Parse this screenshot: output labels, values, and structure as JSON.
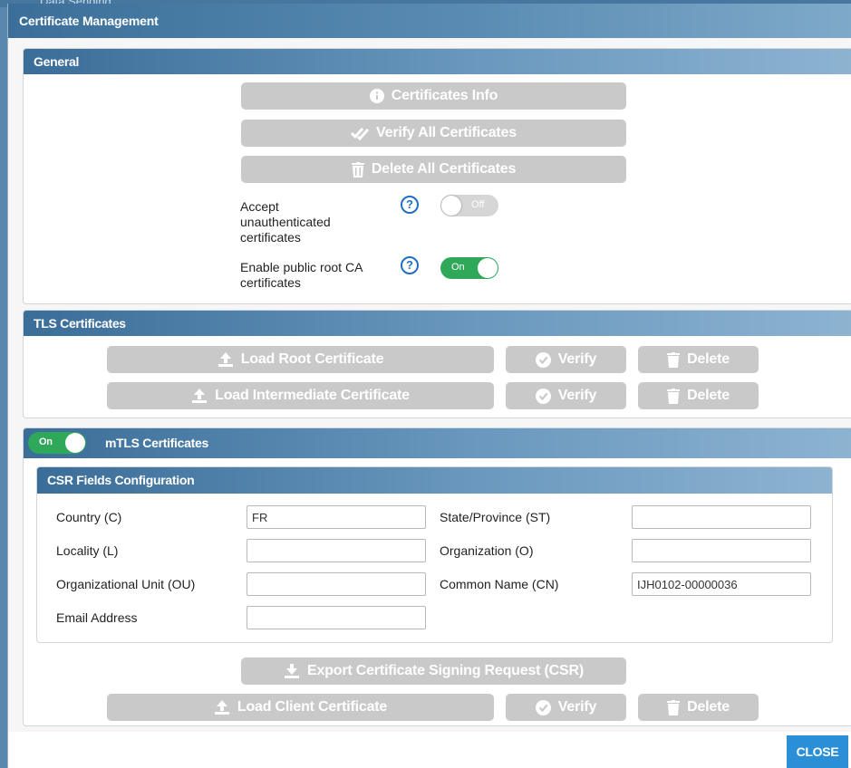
{
  "backdrop": {
    "title_partial": "Data Sending"
  },
  "dialog": {
    "title": "Certificate Management"
  },
  "general": {
    "header": "General",
    "buttons": {
      "info": "Certificates Info",
      "verify_all": "Verify All Certificates",
      "delete_all": "Delete All Certificates"
    },
    "options": [
      {
        "label": "Accept unauthenticated certificates",
        "state": "Off"
      },
      {
        "label": "Enable public root CA certificates",
        "state": "On"
      }
    ]
  },
  "tls": {
    "header": "TLS Certificates",
    "rows": [
      {
        "load": "Load Root Certificate",
        "verify": "Verify",
        "delete": "Delete"
      },
      {
        "load": "Load Intermediate Certificate",
        "verify": "Verify",
        "delete": "Delete"
      }
    ]
  },
  "mtls": {
    "toggle_state": "On",
    "header": "mTLS Certificates",
    "csr": {
      "header": "CSR Fields Configuration",
      "fields": [
        {
          "label": "Country (C)",
          "value": "FR"
        },
        {
          "label": "State/Province (ST)",
          "value": ""
        },
        {
          "label": "Locality (L)",
          "value": ""
        },
        {
          "label": "Organization (O)",
          "value": ""
        },
        {
          "label": "Organizational Unit (OU)",
          "value": ""
        },
        {
          "label": "Common Name (CN)",
          "value": "IJH0102-00000036"
        },
        {
          "label": "Email Address",
          "value": ""
        }
      ]
    },
    "export_label": "Export Certificate Signing Request (CSR)",
    "client": {
      "load": "Load Client Certificate",
      "verify": "Verify",
      "delete": "Delete"
    }
  },
  "footer": {
    "close_label": "CLOSE"
  },
  "colors": {
    "header_blue": "#3a6d98",
    "button_disabled": "#c9c9c9",
    "toggle_on": "#2fa85a",
    "help_blue": "#1f6fc2",
    "close_blue": "#2b8fd8"
  }
}
